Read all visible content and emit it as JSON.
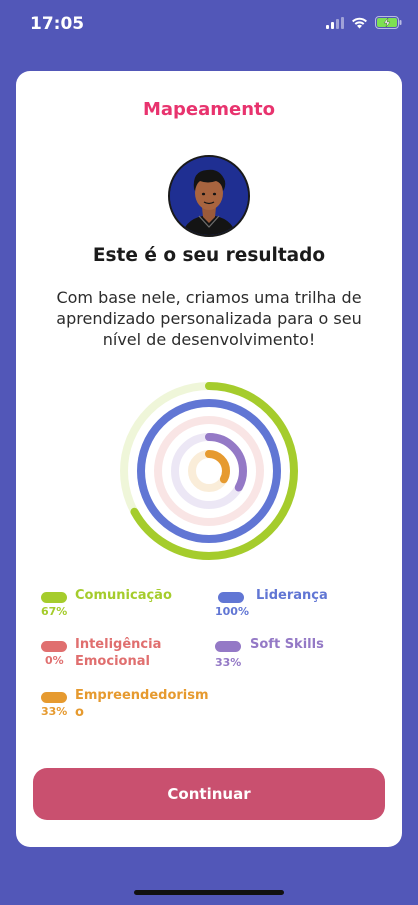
{
  "status_bar": {
    "time": "17:05"
  },
  "header": {
    "title": "Mapeamento"
  },
  "result": {
    "headline": "Este é o seu resultado",
    "description": "Com base nele, criamos uma trilha de aprendizado personalizada para o seu nível de desenvolvimento!"
  },
  "chart_data": {
    "type": "radial-progress",
    "series": [
      {
        "name": "Comunicação",
        "value": 67,
        "label": "67%",
        "color": "#a5cc2c"
      },
      {
        "name": "Liderança",
        "value": 100,
        "label": "100%",
        "color": "#6176d4"
      },
      {
        "name": "Inteligência Emocional",
        "value": 0,
        "label": "0%",
        "color": "#e06f6f"
      },
      {
        "name": "Soft Skills",
        "value": 33,
        "label": "33%",
        "color": "#9479c6"
      },
      {
        "name": "Empreendedorismo",
        "value": 33,
        "label": "33%",
        "color": "#e69a2f"
      }
    ]
  },
  "legend": {
    "comunicacao": {
      "label": "Comunicação",
      "pct": "67%"
    },
    "lideranca": {
      "label": "Liderança",
      "pct": "100%"
    },
    "inteligencia_line1": "Inteligência",
    "inteligencia_line2": "Emocional",
    "inteligencia_pct": "0%",
    "softskills": {
      "label": "Soft Skills",
      "pct": "33%"
    },
    "empreend_line1": "Empreendedorism",
    "empreend_line2": "o",
    "empreend_pct": "33%"
  },
  "footer": {
    "continue_label": "Continuar"
  },
  "colors": {
    "background": "#5257b8",
    "title": "#e8336e",
    "button": "#c9506f"
  }
}
